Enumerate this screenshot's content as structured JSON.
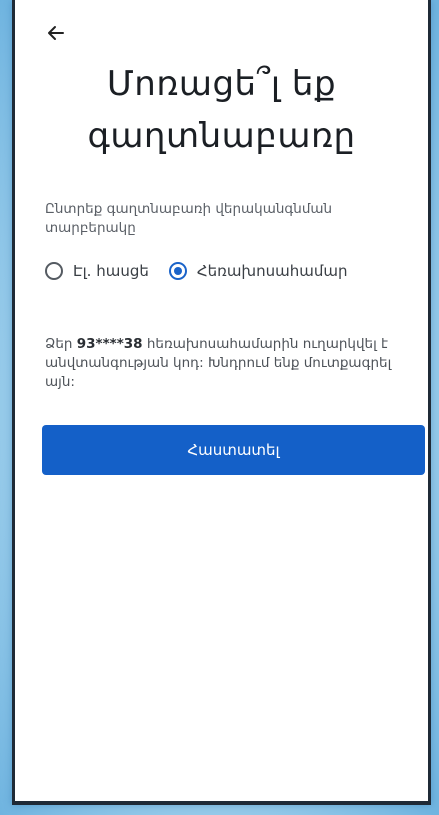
{
  "header": {
    "back_icon": "arrow-left-icon"
  },
  "title": {
    "line1": "Մոռացե՞լ եք",
    "line2": "գաղտնաբառը"
  },
  "subtitle": "Ընտրեք գաղտնաբառի վերականգնման տարբերակը",
  "recovery_options": [
    {
      "label": "Էլ. հասցե",
      "selected": false
    },
    {
      "label": "Հեռախոսահամար",
      "selected": true
    }
  ],
  "info": {
    "prefix": "Ձեր ",
    "phone_masked": "93****38",
    "suffix": " հեռախոսահամարին ուղարկվել է անվտանգության կոդ: Խնդրում ենք մուտքագրել այն:"
  },
  "confirm_button": {
    "label": "Հաստատել"
  },
  "colors": {
    "accent": "#1460c8",
    "text": "#1b1f24",
    "muted": "#5a5f66"
  }
}
